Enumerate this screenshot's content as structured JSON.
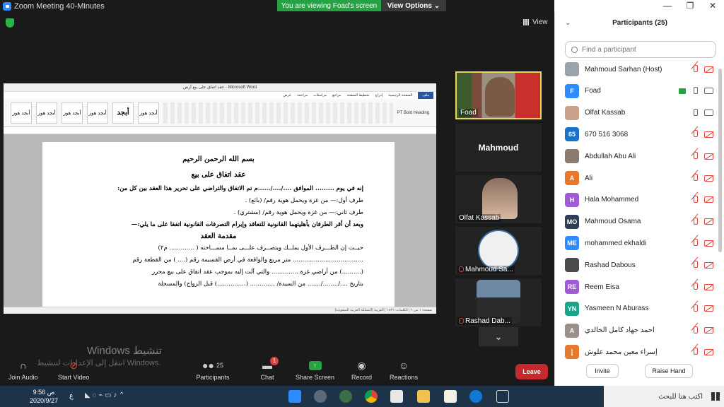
{
  "window": {
    "title": "Zoom Meeting 40-Minutes"
  },
  "banner": {
    "viewing": "You are viewing Foad's screen",
    "view_options": "View Options"
  },
  "gallery_view_label": "View",
  "word": {
    "title": "عقد اتفاق على بيع أرض - Microsoft Word",
    "tabs": [
      "ملف",
      "الصفحة الرئيسية",
      "إدراج",
      "تخطيط الصفحة",
      "مراجع",
      "مراسلات",
      "مراجعة",
      "عرض"
    ],
    "styles": [
      "أبجد هوز",
      "أبجد هوز",
      "أبجد هوز",
      "أبجد هوز",
      "أبجد",
      "أبجد هوز"
    ],
    "font_name": "PT Bold Heading",
    "status": "صفحة: ١ من ٦  |  الكلمات: ١٨٣٦  |  العربية (المملكة العربية السعودية)",
    "doc": {
      "l1": "بسم الله الرحمن الرحيم",
      "l2": "عقد اتفاق على بيع",
      "l3": "إنه في يوم .........   الموافق ..../..../......م   تم الاتفاق والتراضي على تحرير هذا العقد بين كل من:",
      "l4": "طرف أول:—                   من غزة ويحمل هوية رقم/                  (بائع) .",
      "l5": "طرف ثاني:—                  من غزة ويحمل هوية رقم/                  (مشتري) .",
      "l6": "وبعد أن أقر الطرفان بأهليتهما القانونية للتعاقد وإبرام التصرفات القانونية اتفقا على ما يلي:—",
      "l7": "مقدمة العقد",
      "l8": "حيــث إن الطـــرف الأول يملــك ويتصــرف علـــى بمــا مســـاحته ( ............. م٢)",
      "l9": "..................................... متر مربع  والواقعة في أرض القسيمة رقم (.... ) من القطعة رقم",
      "l10": "(..........) من أراضي غزة   ..............   والتي آلت إليه بموجب عقد اتفاق على بيع محرر",
      "l11": "بتاريخ ..../......../.......   من السيدة/ ............. (...............) قبل الزواج) والمسجلة"
    }
  },
  "tiles": [
    {
      "name": "Foad",
      "active": true
    },
    {
      "name": "Mahmoud",
      "active": false
    },
    {
      "name": "Olfat Kassab",
      "active": false
    },
    {
      "name": "Mahmoud Sa...",
      "active": false
    },
    {
      "name": "Rashad Dab...",
      "active": false
    }
  ],
  "toolbar": {
    "join_audio": "Join Audio",
    "start_video": "Start Video",
    "participants": "Participants",
    "participants_count": "25",
    "chat": "Chat",
    "chat_badge": "1",
    "share_screen": "Share Screen",
    "record": "Record",
    "reactions": "Reactions",
    "leave": "Leave"
  },
  "watermark": {
    "line1": "Windows تنشيط",
    "line2": "انتقل إلى الإعدادات لتنشيط Windows."
  },
  "panel": {
    "title": "Participants (25)",
    "search_placeholder": "Find a participant",
    "invite": "Invite",
    "raise_hand": "Raise Hand",
    "participants": [
      {
        "name": "Mahmoud Sarhan (Host)",
        "initials": "",
        "color": "#9aa3ab",
        "mic": "off",
        "cam": "off",
        "share": false
      },
      {
        "name": "Foad",
        "initials": "F",
        "color": "#2d8cff",
        "mic": "on",
        "cam": "on",
        "share": true
      },
      {
        "name": "Olfat Kassab",
        "initials": "",
        "color": "#c9a08a",
        "mic": "on",
        "cam": "on",
        "share": false
      },
      {
        "name": "670 516 3068",
        "initials": "65",
        "color": "#1a73c8",
        "mic": "off",
        "cam": "off",
        "share": false
      },
      {
        "name": "Abdullah Abu Ali",
        "initials": "",
        "color": "#8c7a6e",
        "mic": "off",
        "cam": "off",
        "share": false
      },
      {
        "name": "Ali",
        "initials": "A",
        "color": "#e8782e",
        "mic": "off",
        "cam": "off",
        "share": false
      },
      {
        "name": "Hala Mohammed",
        "initials": "H",
        "color": "#a15bd6",
        "mic": "off",
        "cam": "off",
        "share": false
      },
      {
        "name": "Mahmoud Osama",
        "initials": "MO",
        "color": "#2f3e55",
        "mic": "off",
        "cam": "off",
        "share": false
      },
      {
        "name": "mohammed ekhaldi",
        "initials": "ME",
        "color": "#2d8cff",
        "mic": "off",
        "cam": "off",
        "share": false
      },
      {
        "name": "Rashad Dabous",
        "initials": "",
        "color": "#4a4a4a",
        "mic": "off",
        "cam": "off",
        "share": false
      },
      {
        "name": "Reem Eisa",
        "initials": "RE",
        "color": "#a15bd6",
        "mic": "off",
        "cam": "off",
        "share": false
      },
      {
        "name": "Yasmeen N Aburass",
        "initials": "YN",
        "color": "#19a58a",
        "mic": "off",
        "cam": "off",
        "share": false
      },
      {
        "name": "أحمد جهاد كامل الخالدي",
        "initials": "A",
        "color": "#9a8f8a",
        "mic": "off",
        "cam": "off",
        "share": false
      },
      {
        "name": "إسراء معين محمد علوش",
        "initials": "إ",
        "color": "#e8782e",
        "mic": "off",
        "cam": "off",
        "share": false
      }
    ]
  },
  "taskbar": {
    "search": "اكتب هنا للبحث",
    "time": "9:56 ص",
    "date": "2020/9/27",
    "lang": "ع"
  },
  "colors": {
    "zoom_blue": "#2d8cff",
    "banner_green": "#25a244",
    "leave_red": "#c6282e",
    "tile_border": "#e5d75c"
  }
}
